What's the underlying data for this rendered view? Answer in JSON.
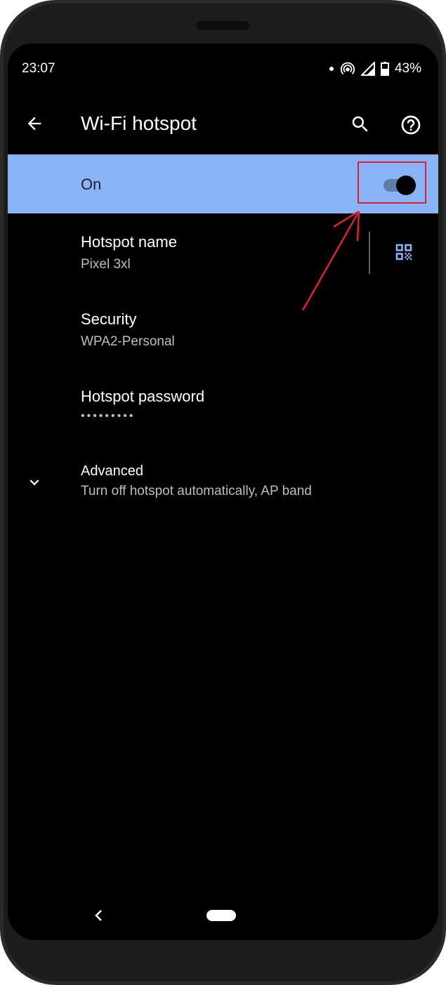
{
  "status_bar": {
    "time": "23:07",
    "battery": "43%",
    "icons": [
      "notification-dot-icon",
      "hotspot-icon",
      "signal-icon",
      "battery-icon"
    ]
  },
  "app_bar": {
    "title": "Wi-Fi hotspot",
    "icons": [
      "back-arrow-icon",
      "search-icon",
      "help-icon"
    ]
  },
  "master_switch": {
    "label": "On",
    "checked": true,
    "background": "#8ab4f8"
  },
  "settings": [
    {
      "title": "Hotspot name",
      "summary": "Pixel 3xl"
    },
    {
      "title": "Security",
      "summary": "WPA2-Personal"
    },
    {
      "title": "Hotspot password",
      "summary": "•••••••••"
    },
    {
      "title": "Advanced",
      "summary": "Turn off hotspot automatically, AP band"
    }
  ],
  "annotation": {
    "color": "#e0202f"
  },
  "nav": {
    "icons": [
      "nav-back-icon",
      "nav-home-pill"
    ]
  }
}
